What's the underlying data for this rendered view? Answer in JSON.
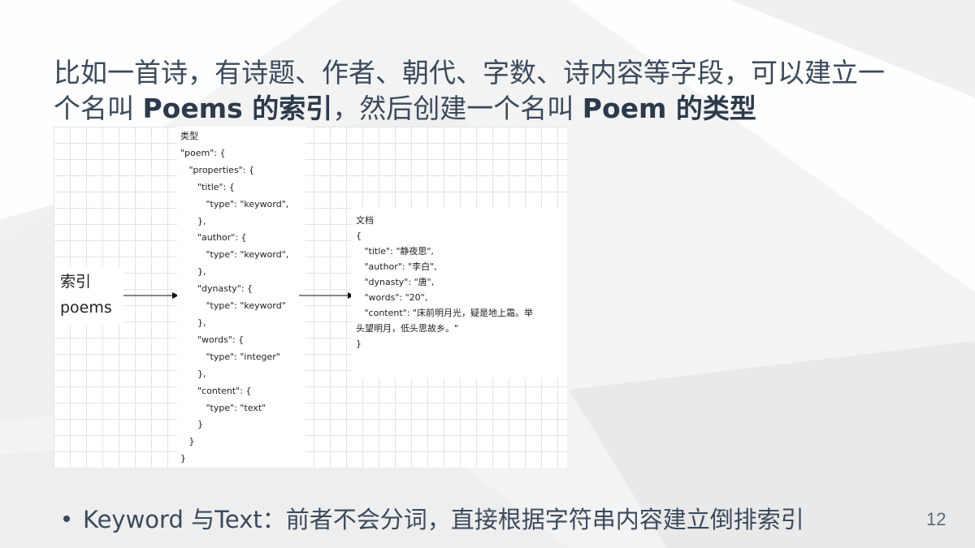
{
  "heading": {
    "line1": "比如一首诗，有诗题、作者、朝代、字数、诗内容等字段，可以建立一",
    "line2_a": "个名叫 ",
    "line2_b": "Poems 的索引",
    "line2_c": "，然后创建一个名叫 ",
    "line2_d": "Poem 的类型"
  },
  "figure": {
    "index_label": "索引",
    "index_name": "poems",
    "type_block": "类型\n\"poem\": {\n   \"properties\": {\n      \"title\": {\n         \"type\": \"keyword\",\n      },\n      \"author\": {\n         \"type\": \"keyword\",\n      },\n      \"dynasty\": {\n         \"type\": \"keyword\"\n      },\n      \"words\": {\n         \"type\": \"integer\"\n      },\n      \"content\": {\n         \"type\": \"text\"\n      }\n   }\n}",
    "doc_block": "文档\n{\n   \"title\": \"静夜思\",\n   \"author\": \"李白\",\n   \"dynasty\": \"唐\",\n   \"words\": \"20\",\n   \"content\": \"床前明月光，疑是地上霜。举\n头望明月，低头思故乡。\"\n}"
  },
  "bullet": {
    "text": "Keyword 与Text：前者不会分词，直接根据字符串内容建立倒排索引"
  },
  "page_number": "12",
  "colors": {
    "text": "#3b4a5c",
    "background": "#f4f4f4"
  }
}
